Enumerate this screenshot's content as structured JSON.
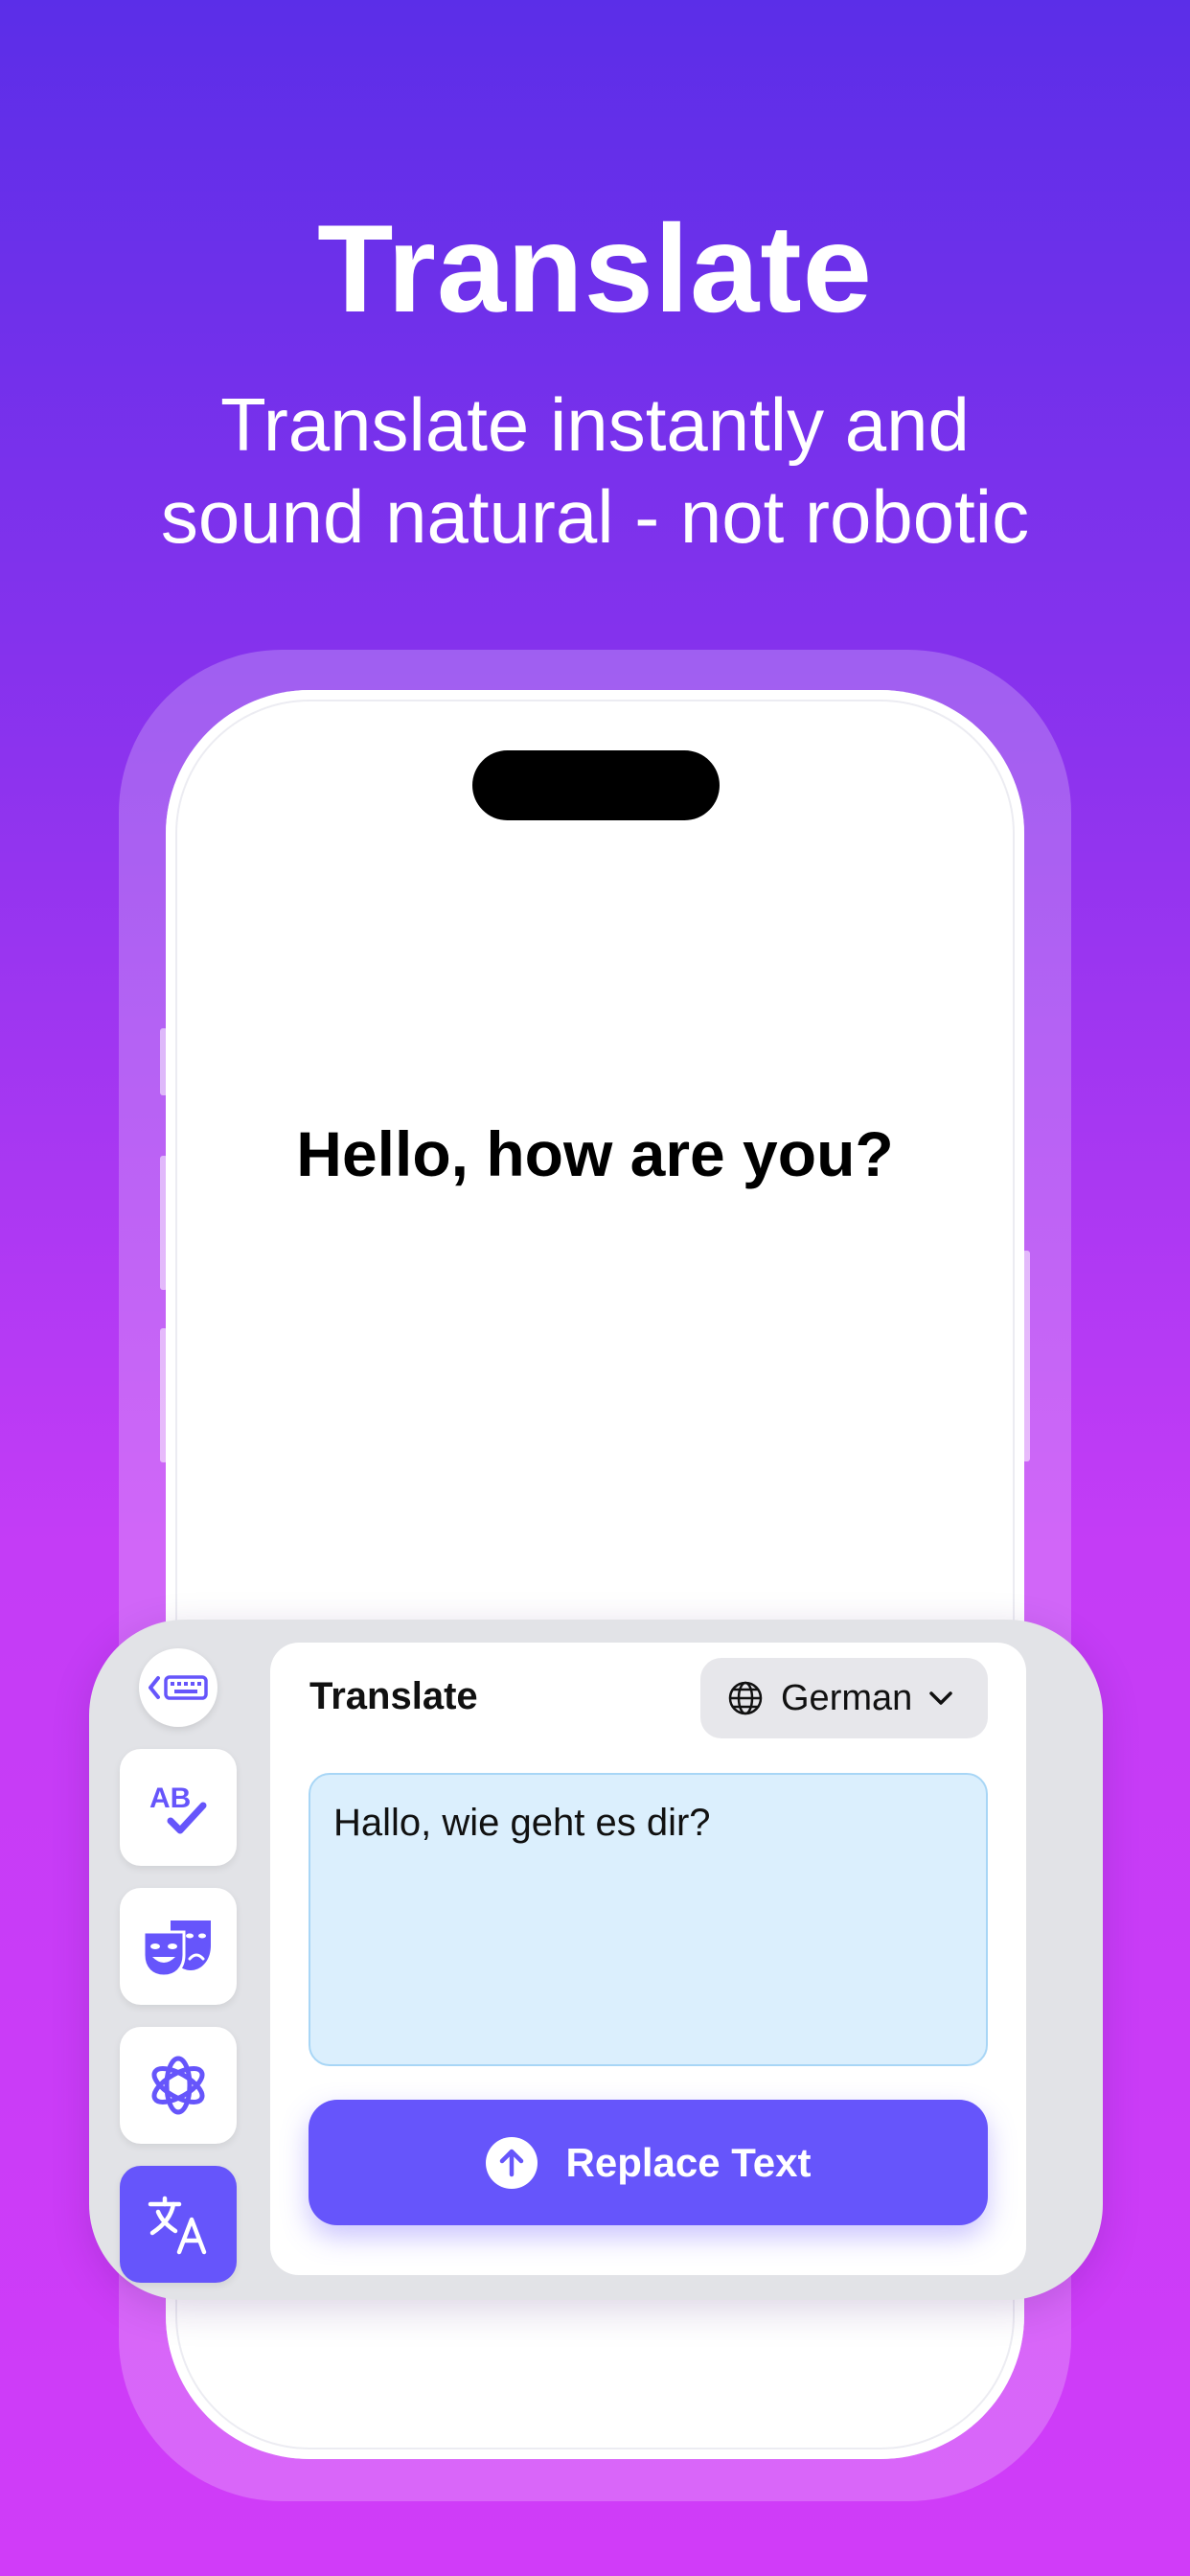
{
  "headline": "Translate",
  "subheadline": {
    "line1": "Translate instantly and",
    "line2": "sound natural - not robotic"
  },
  "phone": {
    "screen_text": "Hello, how are you?"
  },
  "keyboard": {
    "card_title": "Translate",
    "language": {
      "selected": "German",
      "icon": "globe-icon"
    },
    "translated_text": "Hallo, wie geht es dir?",
    "replace_button_label": "Replace Text",
    "sidebar_tools": [
      {
        "icon": "keyboard-back-icon"
      },
      {
        "icon": "spellcheck-icon"
      },
      {
        "icon": "theater-masks-icon"
      },
      {
        "icon": "ai-knot-icon"
      },
      {
        "icon": "translate-icon",
        "active": true
      }
    ]
  },
  "colors": {
    "accent": "#6655fb",
    "text_area_bg": "#dbeffd",
    "panel_bg": "#e2e3e7"
  }
}
